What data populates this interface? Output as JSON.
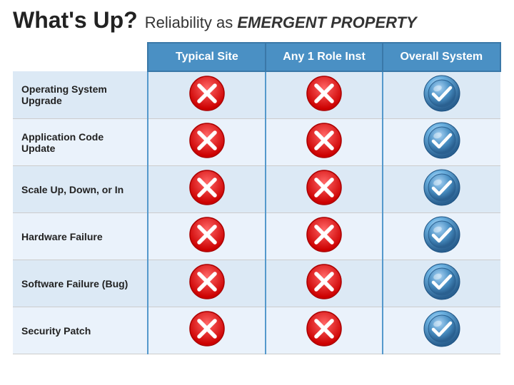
{
  "title": {
    "bold": "What's Up?",
    "rest": "Reliability as ",
    "emphasis": "EMERGENT PROPERTY"
  },
  "columns": {
    "col1": "Typical Site",
    "col2": "Any 1 Role Inst",
    "col3": "Overall System"
  },
  "rows": [
    {
      "label": "Operating System Upgrade",
      "typical": "x",
      "any1": "x",
      "overall": "check"
    },
    {
      "label": "Application Code Update",
      "typical": "x",
      "any1": "x",
      "overall": "check"
    },
    {
      "label": "Scale Up, Down, or In",
      "typical": "x",
      "any1": "x",
      "overall": "check"
    },
    {
      "label": "Hardware Failure",
      "typical": "x",
      "any1": "x",
      "overall": "check"
    },
    {
      "label": "Software Failure (Bug)",
      "typical": "x",
      "any1": "x",
      "overall": "check"
    },
    {
      "label": "Security Patch",
      "typical": "x",
      "any1": "x",
      "overall": "check"
    }
  ]
}
